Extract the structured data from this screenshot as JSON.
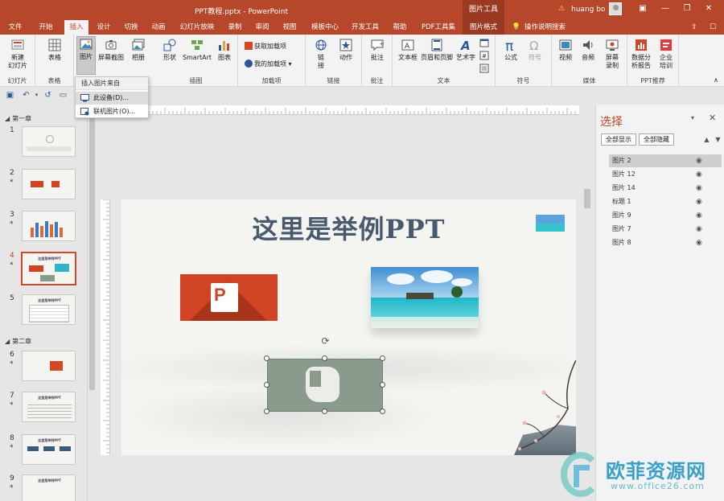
{
  "window": {
    "title": "PPT教程.pptx - PowerPoint",
    "context_tools": "图片工具",
    "user": "huang bo",
    "minimize": "—",
    "restore": "❐",
    "close": "✕"
  },
  "tabs": [
    {
      "label": "文件"
    },
    {
      "label": "开始"
    },
    {
      "label": "插入"
    },
    {
      "label": "设计"
    },
    {
      "label": "切换"
    },
    {
      "label": "动画"
    },
    {
      "label": "幻灯片放映"
    },
    {
      "label": "录制"
    },
    {
      "label": "审阅"
    },
    {
      "label": "视图"
    },
    {
      "label": "模板中心"
    },
    {
      "label": "开发工具"
    },
    {
      "label": "帮助"
    },
    {
      "label": "PDF工具集"
    },
    {
      "label": "图片格式"
    }
  ],
  "tell_me": "操作说明搜索",
  "ribbon": {
    "groups": {
      "slides": "幻灯片",
      "tables": "表格",
      "images": "插图",
      "addins": "加载项",
      "links": "链接",
      "comments": "批注",
      "text": "文本",
      "symbols": "符号",
      "media": "媒体",
      "ppt_recommend": "PPT推荐"
    },
    "buttons": {
      "new_slide_1": "新建",
      "new_slide_2": "幻灯片",
      "table": "表格",
      "picture": "图片",
      "screenshot": "屏幕截图",
      "album": "相册",
      "shapes": "形状",
      "smartart": "SmartArt",
      "chart": "图表",
      "get_addins": "获取加载项",
      "my_addins": "我的加载项",
      "link_1": "链",
      "link_2": "接",
      "action": "动作",
      "comment": "批注",
      "textbox": "文本框",
      "header_footer": "页眉和页脚",
      "wordart": "艺术字",
      "equation": "公式",
      "symbol": "符号",
      "video": "视频",
      "audio": "音频",
      "screen_rec_1": "屏幕",
      "screen_rec_2": "录制",
      "data_report_1": "数据分",
      "data_report_2": "析报告",
      "enterprise_1": "企业",
      "enterprise_2": "培训"
    }
  },
  "dropdown": {
    "header": "插入图片来自",
    "items": [
      {
        "label": "此设备(D)..."
      },
      {
        "label": "联机图片(O)..."
      }
    ]
  },
  "thumbnails": {
    "sections": [
      "第一章",
      "第二章"
    ],
    "slides": [
      {
        "num": "1",
        "star": ""
      },
      {
        "num": "2",
        "star": "*"
      },
      {
        "num": "3",
        "star": "*"
      },
      {
        "num": "4",
        "star": "*"
      },
      {
        "num": "5",
        "star": ""
      },
      {
        "num": "6",
        "star": "*"
      },
      {
        "num": "7",
        "star": "*"
      },
      {
        "num": "8",
        "star": "*"
      },
      {
        "num": "9",
        "star": "*"
      }
    ]
  },
  "slide": {
    "title": "这里是举例PPT"
  },
  "selection_pane": {
    "title": "选择",
    "show_all": "全部显示",
    "hide_all": "全部隐藏",
    "items": [
      {
        "label": "图片 2",
        "selected": true
      },
      {
        "label": "图片 12"
      },
      {
        "label": "图片 14"
      },
      {
        "label": "标题 1"
      },
      {
        "label": "图片 9"
      },
      {
        "label": "图片 7"
      },
      {
        "label": "图片 8"
      }
    ]
  },
  "watermark": {
    "name": "欧菲资源网",
    "url": "www.office26.com"
  },
  "colors": {
    "brand": "#b7472a",
    "ribbon_bg": "#f3f3f3",
    "selected_thumb_border": "#d24726"
  }
}
